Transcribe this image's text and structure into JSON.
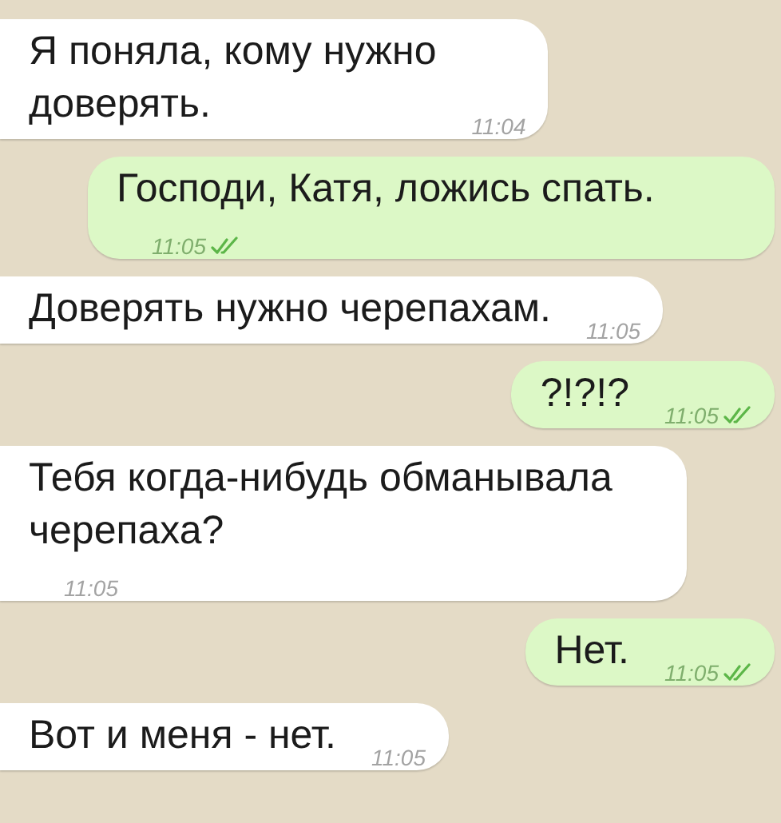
{
  "messages": [
    {
      "kind": "incoming",
      "text": "Я поняла, кому нужно\nдоверять.",
      "time": "11:04"
    },
    {
      "kind": "outgoing",
      "text": "Господи, Катя, ложись спать.",
      "time": "11:05",
      "read": true
    },
    {
      "kind": "incoming",
      "text": "Доверять нужно черепахам.",
      "time": "11:05"
    },
    {
      "kind": "outgoing",
      "text": "?!?!?",
      "time": "11:05",
      "read": true
    },
    {
      "kind": "incoming",
      "text": "Тебя когда-нибудь обманывала\nчерепаха?",
      "time": "11:05"
    },
    {
      "kind": "outgoing",
      "text": "Нет.",
      "time": "11:05",
      "read": true
    },
    {
      "kind": "incoming",
      "text": "Вот и меня - нет.",
      "time": "11:05"
    }
  ]
}
